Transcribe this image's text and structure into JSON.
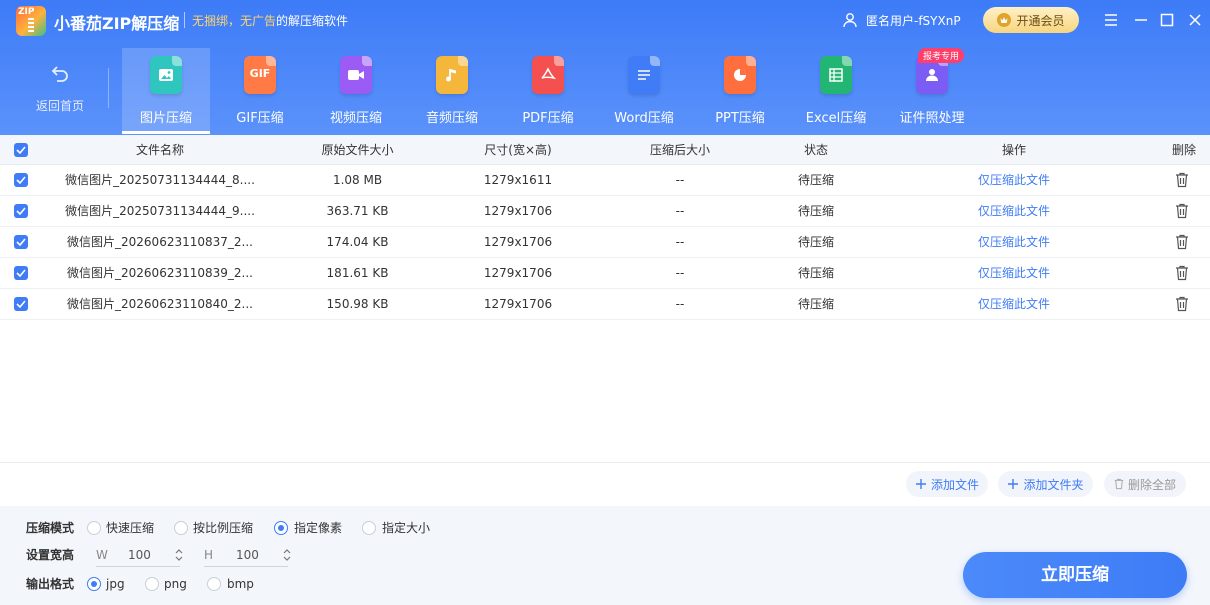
{
  "app": {
    "logo_text": "ZIP",
    "title": "小番茄ZIP解压缩",
    "slogan_highlight": "无捆绑，无广告",
    "slogan_rest": "的解压缩软件",
    "user_name": "匿名用户-fSYXnP",
    "vip_label": "开通会员"
  },
  "nav": {
    "back_label": "返回首页",
    "tools": [
      {
        "label": "图片压缩",
        "color": "#2fc6c0",
        "glyph": "",
        "icon": "image-icon"
      },
      {
        "label": "GIF压缩",
        "color": "#ff7a45",
        "glyph": "GIF",
        "icon": "gif-icon"
      },
      {
        "label": "视频压缩",
        "color": "#9b5cf6",
        "glyph": "",
        "icon": "video-icon"
      },
      {
        "label": "音频压缩",
        "color": "#f5b73b",
        "glyph": "",
        "icon": "music-icon"
      },
      {
        "label": "PDF压缩",
        "color": "#f4504f",
        "glyph": "",
        "icon": "pdf-icon"
      },
      {
        "label": "Word压缩",
        "color": "#3f7cf5",
        "glyph": "",
        "icon": "word-icon"
      },
      {
        "label": "PPT压缩",
        "color": "#ff6f3d",
        "glyph": "",
        "icon": "ppt-icon"
      },
      {
        "label": "Excel压缩",
        "color": "#22b573",
        "glyph": "",
        "icon": "excel-icon"
      },
      {
        "label": "证件照处理",
        "color": "#7b5cf5",
        "glyph": "",
        "icon": "id-photo-icon",
        "badge": "报考专用"
      }
    ]
  },
  "table": {
    "headers": {
      "name": "文件名称",
      "orig_size": "原始文件大小",
      "dimension": "尺寸(宽×高)",
      "comp_size": "压缩后大小",
      "status": "状态",
      "action": "操作",
      "delete": "删除"
    },
    "rows": [
      {
        "name": "微信图片_20250731134444_8....",
        "orig_size": "1.08 MB",
        "dimension": "1279x1611",
        "comp_size": "--",
        "status": "待压缩",
        "action": "仅压缩此文件"
      },
      {
        "name": "微信图片_20250731134444_9....",
        "orig_size": "363.71 KB",
        "dimension": "1279x1706",
        "comp_size": "--",
        "status": "待压缩",
        "action": "仅压缩此文件"
      },
      {
        "name": "微信图片_20260623110837_2...",
        "orig_size": "174.04 KB",
        "dimension": "1279x1706",
        "comp_size": "--",
        "status": "待压缩",
        "action": "仅压缩此文件"
      },
      {
        "name": "微信图片_20260623110839_2...",
        "orig_size": "181.61 KB",
        "dimension": "1279x1706",
        "comp_size": "--",
        "status": "待压缩",
        "action": "仅压缩此文件"
      },
      {
        "name": "微信图片_20260623110840_2...",
        "orig_size": "150.98 KB",
        "dimension": "1279x1706",
        "comp_size": "--",
        "status": "待压缩",
        "action": "仅压缩此文件"
      }
    ]
  },
  "actions": {
    "add_file": "添加文件",
    "add_folder": "添加文件夹",
    "delete_all": "删除全部"
  },
  "settings": {
    "mode_label": "压缩模式",
    "modes": [
      "快速压缩",
      "按比例压缩",
      "指定像素",
      "指定大小"
    ],
    "selected_mode": "指定像素",
    "dim_label": "设置宽高",
    "width_key": "W",
    "width_value": "100",
    "height_key": "H",
    "height_value": "100",
    "format_label": "输出格式",
    "formats": [
      "jpg",
      "png",
      "bmp"
    ],
    "selected_format": "jpg",
    "start_label": "立即压缩"
  },
  "colors": {
    "header_blue": "#3d7bf7",
    "accent": "#3f7cf5"
  }
}
